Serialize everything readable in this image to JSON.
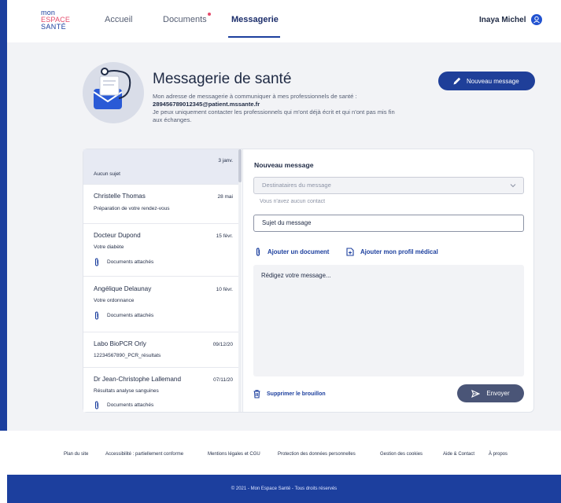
{
  "logo": {
    "line1": "mon",
    "line2": "ESPACE",
    "line3": "SANTÉ"
  },
  "nav": {
    "items": [
      {
        "label": "Accueil"
      },
      {
        "label": "Documents"
      },
      {
        "label": "Messagerie"
      }
    ],
    "active": "Messagerie"
  },
  "user": {
    "name": "Inaya Michel"
  },
  "hero": {
    "title": "Messagerie de santé",
    "line1": "Mon adresse de messagerie à communiquer à mes professionnels de santé :",
    "address": "289456789012345@patient.mssante.fr",
    "line2": "Je peux uniquement contacter les professionnels qui m'ont déjà écrit et qui n'ont pas mis fin aux échanges."
  },
  "new_message_button": "Nouveau message",
  "messages": [
    {
      "sender": "",
      "date": "3 janv.",
      "subject": "Aucun sujet",
      "attachments": ""
    },
    {
      "sender": "Christelle Thomas",
      "date": "28 mai",
      "subject": "Préparation de votre rendez-vous",
      "attachments": ""
    },
    {
      "sender": "Docteur Dupond",
      "date": "15 févr.",
      "subject": "Votre diabète",
      "attachments": "Documents attachés"
    },
    {
      "sender": "Angélique Delaunay",
      "date": "10 févr.",
      "subject": "Votre ordonnance",
      "attachments": "Documents attachés"
    },
    {
      "sender": "Labo BioPCR Orly",
      "date": "09/12/20",
      "subject": "12234567890_PCR_résultats",
      "attachments": ""
    },
    {
      "sender": "Dr Jean-Christophe Lallemand",
      "date": "07/11/20",
      "subject": "Résultats analyse sanguines",
      "attachments": "Documents attachés"
    }
  ],
  "compose": {
    "title": "Nouveau message",
    "recipients_placeholder": "Destinataires du message",
    "no_contact": "Vous n'avez aucun contact",
    "subject_placeholder": "Sujet du message",
    "add_document": "Ajouter un document",
    "add_profile": "Ajouter mon profil médical",
    "body_placeholder": "Rédigez votre message...",
    "delete_draft": "Supprimer le brouillon",
    "send": "Envoyer"
  },
  "footer": {
    "links": [
      "Plan du site",
      "Accessibilité : partiellement conforme",
      "Mentions légales et CGU",
      "Protection des données personnelles",
      "Gestion des cookies",
      "Aide & Contact",
      "À propos"
    ],
    "copyright": "© 2021 - Mon Espace Santé - Tous droits réservés"
  },
  "colors": {
    "brand": "#1c3f9e",
    "accent": "#e54b6b",
    "send_button": "#4a5577",
    "background": "#f2f3f6"
  }
}
